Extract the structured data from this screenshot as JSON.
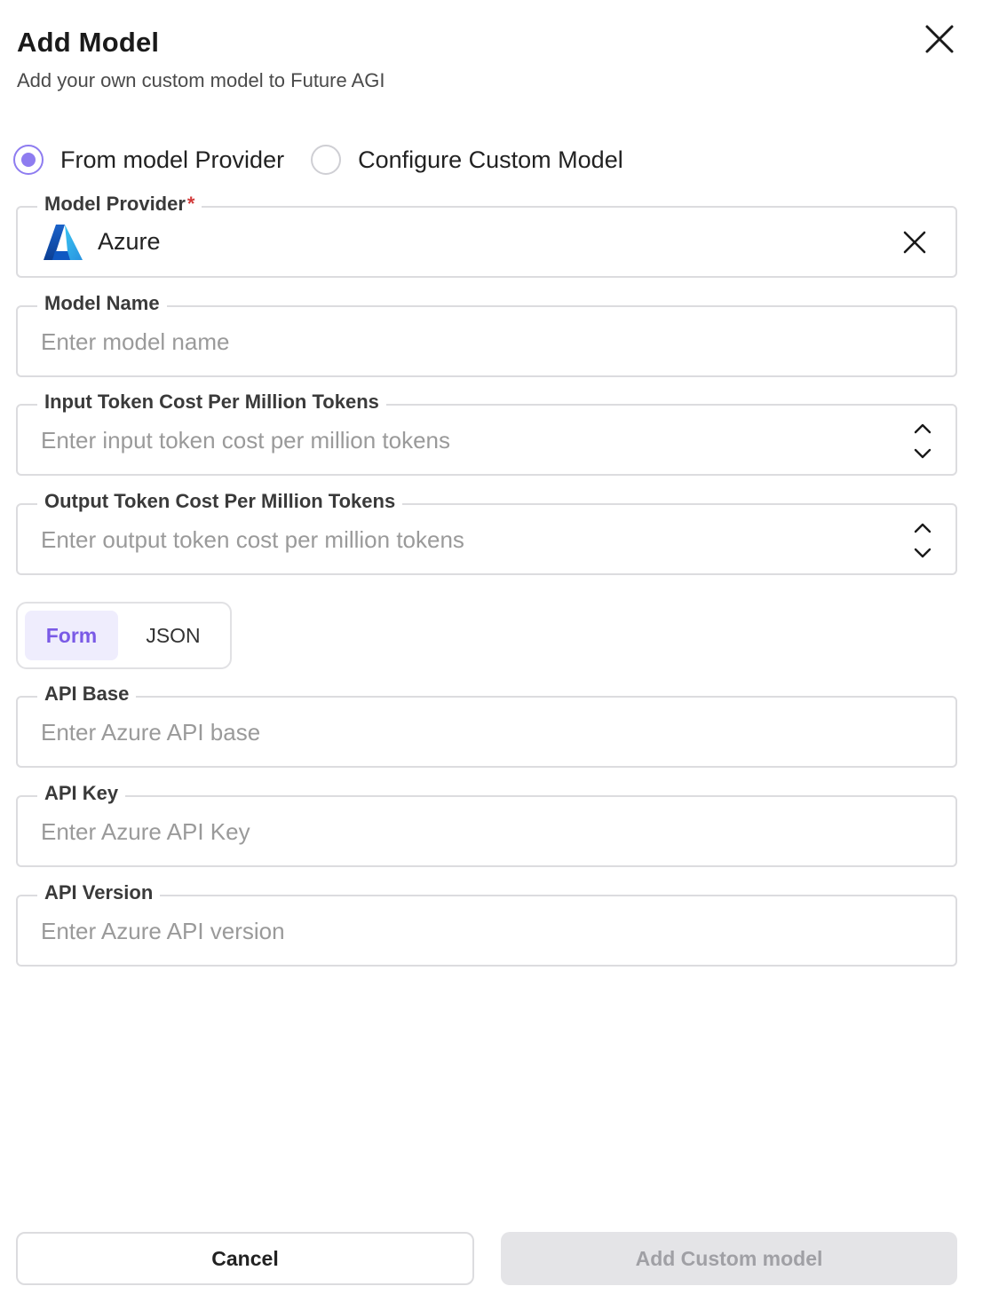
{
  "dialog": {
    "title": "Add Model",
    "subtitle": "Add your own custom model to Future AGI"
  },
  "source_options": [
    {
      "label": "From model Provider",
      "selected": true
    },
    {
      "label": "Configure Custom Model",
      "selected": false
    }
  ],
  "fields": {
    "model_provider": {
      "label": "Model Provider",
      "required_mark": "*",
      "value": "Azure",
      "logo": "azure-logo"
    },
    "model_name": {
      "label": "Model Name",
      "placeholder": "Enter model name"
    },
    "input_cost": {
      "label": "Input Token Cost Per Million Tokens",
      "placeholder": "Enter input token cost per million tokens"
    },
    "output_cost": {
      "label": "Output Token Cost Per Million Tokens",
      "placeholder": "Enter output token cost per million tokens"
    },
    "api_base": {
      "label": "API Base",
      "placeholder": "Enter Azure API base"
    },
    "api_key": {
      "label": "API Key",
      "placeholder": "Enter Azure API Key"
    },
    "api_version": {
      "label": "API Version",
      "placeholder": "Enter Azure API version"
    }
  },
  "mode_toggle": {
    "options": [
      "Form",
      "JSON"
    ],
    "active": "Form"
  },
  "footer": {
    "cancel_label": "Cancel",
    "submit_label": "Add Custom model"
  },
  "colors": {
    "accent": "#8e7cf0",
    "accent_text": "#7a5ae6",
    "required": "#d23b3b",
    "border": "#dcdcdf",
    "disabled_bg": "#e4e4e7"
  }
}
